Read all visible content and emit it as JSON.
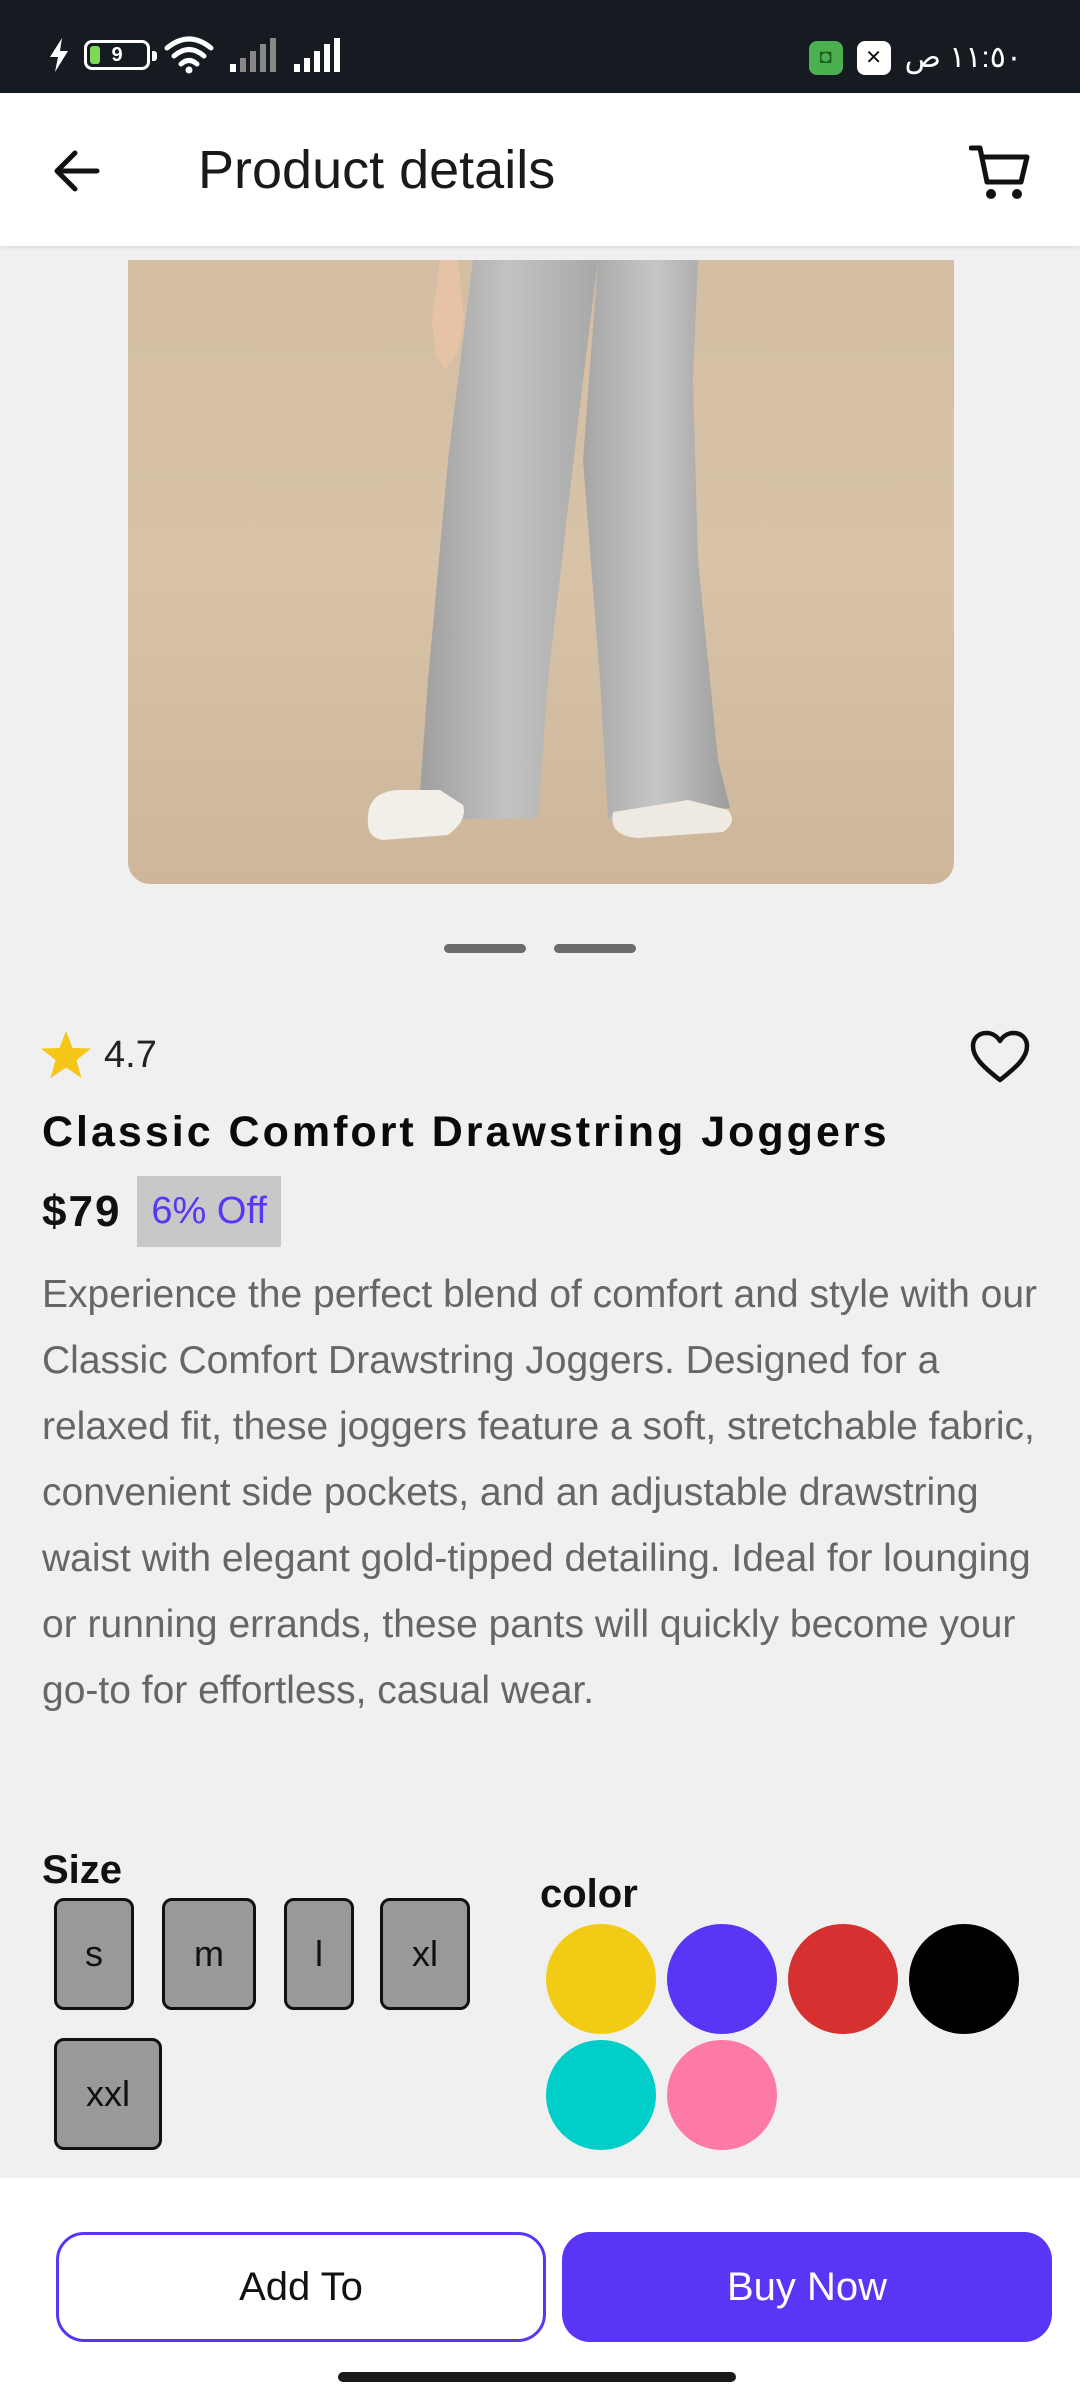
{
  "status_bar": {
    "battery_level": "9",
    "time": "١١:٥٠ ص",
    "app_badge_1_color": "#4caf50",
    "app_badge_2_color": "#ffffff"
  },
  "header": {
    "title": "Product details",
    "back_icon": "arrow-left-icon",
    "cart_icon": "shopping-cart-icon"
  },
  "carousel": {
    "page_count": 2
  },
  "product": {
    "rating": "4.7",
    "name": "Classic Comfort Drawstring Joggers",
    "price": "$79",
    "discount": "6% Off",
    "description": "Experience the perfect blend of comfort and style with our Classic Comfort Drawstring Joggers. Designed for a relaxed fit, these joggers feature a soft, stretchable fabric, convenient side pockets, and an adjustable drawstring waist with elegant gold-tipped detailing. Ideal for lounging or running errands, these pants will quickly become your go-to for effortless, casual wear."
  },
  "sizes": {
    "label": "Size",
    "options": [
      "s",
      "m",
      "l",
      "xl",
      "xxl"
    ]
  },
  "colors": {
    "label": "color",
    "options": [
      "#f2cc14",
      "#5b35f5",
      "#d63031",
      "#000000",
      "#00cec9",
      "#fd79a8"
    ]
  },
  "actions": {
    "add_label": "Add To",
    "buy_label": "Buy Now",
    "accent": "#5b35f5"
  }
}
